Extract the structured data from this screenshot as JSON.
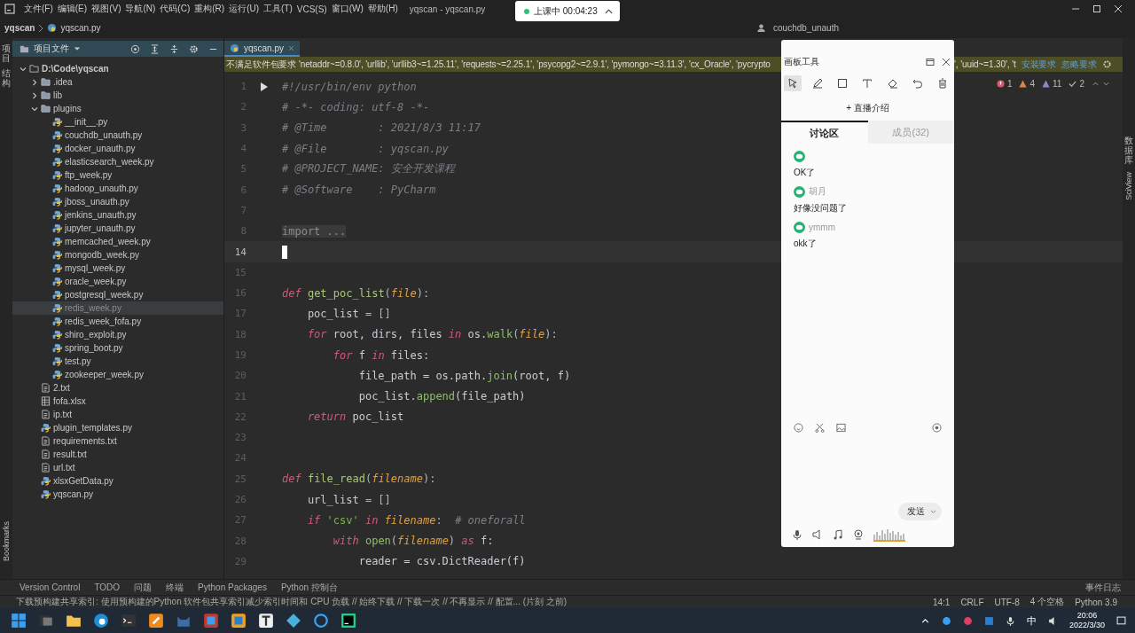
{
  "menu": [
    "文件(F)",
    "编辑(E)",
    "视图(V)",
    "导航(N)",
    "代码(C)",
    "重构(R)",
    "运行(U)",
    "工具(T)",
    "VCS(S)",
    "窗口(W)",
    "帮助(H)"
  ],
  "window": {
    "title": "yqscan - yqscan.py"
  },
  "class_timer": {
    "label": "上课中 00:04:23"
  },
  "breadcrumb": [
    "yqscan",
    "yqscan.py"
  ],
  "run_config": "couchdb_unauth",
  "left_strip": [
    "项目",
    "结构"
  ],
  "bookmarks_label": "Bookmarks",
  "project_panel": {
    "title": "项目文件",
    "tree": [
      {
        "name": "D:\\Code\\yqscan",
        "kind": "folder",
        "expanded": true,
        "selected": false,
        "children": [
          {
            "name": ".idea",
            "kind": "folder",
            "expanded": false,
            "selected": false
          },
          {
            "name": "lib",
            "kind": "folder",
            "expanded": false,
            "selected": false
          },
          {
            "name": "plugins",
            "kind": "folder",
            "expanded": true,
            "selected": false,
            "children": [
              {
                "name": "__init__.py",
                "kind": "init",
                "selected": false
              },
              {
                "name": "couchdb_unauth.py",
                "kind": "python",
                "selected": false
              },
              {
                "name": "docker_unauth.py",
                "kind": "python",
                "selected": false
              },
              {
                "name": "elasticsearch_week.py",
                "kind": "python",
                "selected": false
              },
              {
                "name": "ftp_week.py",
                "kind": "python",
                "selected": false
              },
              {
                "name": "hadoop_unauth.py",
                "kind": "python",
                "selected": false
              },
              {
                "name": "jboss_unauth.py",
                "kind": "python",
                "selected": false
              },
              {
                "name": "jenkins_unauth.py",
                "kind": "python",
                "selected": false
              },
              {
                "name": "jupyter_unauth.py",
                "kind": "python",
                "selected": false
              },
              {
                "name": "memcached_week.py",
                "kind": "python",
                "selected": false
              },
              {
                "name": "mongodb_week.py",
                "kind": "python",
                "selected": false
              },
              {
                "name": "mysql_week.py",
                "kind": "python",
                "selected": false
              },
              {
                "name": "oracle_week.py",
                "kind": "python",
                "selected": false
              },
              {
                "name": "postgresql_week.py",
                "kind": "python",
                "selected": false
              },
              {
                "name": "redis_week.py",
                "kind": "python",
                "selected": true
              },
              {
                "name": "redis_week_fofa.py",
                "kind": "python",
                "selected": false
              },
              {
                "name": "shiro_exploit.py",
                "kind": "python",
                "selected": false
              },
              {
                "name": "spring_boot.py",
                "kind": "python",
                "selected": false
              },
              {
                "name": "test.py",
                "kind": "python",
                "selected": false
              },
              {
                "name": "zookeeper_week.py",
                "kind": "python",
                "selected": false
              }
            ]
          },
          {
            "name": "2.txt",
            "kind": "text",
            "selected": false
          },
          {
            "name": "fofa.xlsx",
            "kind": "excel",
            "selected": false
          },
          {
            "name": "ip.txt",
            "kind": "text",
            "selected": false
          },
          {
            "name": "plugin_templates.py",
            "kind": "python",
            "selected": false
          },
          {
            "name": "requirements.txt",
            "kind": "requirements",
            "selected": false
          },
          {
            "name": "result.txt",
            "kind": "text",
            "selected": false
          },
          {
            "name": "url.txt",
            "kind": "text",
            "selected": false
          },
          {
            "name": "xlsxGetData.py",
            "kind": "python",
            "selected": false
          },
          {
            "name": "yqscan.py",
            "kind": "python",
            "selected": false
          }
        ]
      }
    ]
  },
  "editor_tab": {
    "label": "yqscan.py"
  },
  "requirements_bar": {
    "text": "不满足软件包要求 'netaddr~=0.8.0', 'urllib', 'urllib3~=1.25.11', 'requests~=2.25.1', 'psycopg2~=2.9.1', 'pymongo~=3.11.3', 'cx_Oracle', 'pycrypto",
    "text_end": "', 'uuid~=1.30', 't",
    "install": "安装要求",
    "ignore": "忽略要求"
  },
  "inspections": {
    "errors": "1",
    "warnings": "4",
    "weak_warnings": "11",
    "typos": "2"
  },
  "code": [
    {
      "number": "1",
      "current": false,
      "tokens": [
        {
          "t": "#!/usr/bin/env python",
          "kind": "comment"
        }
      ]
    },
    {
      "number": "2",
      "current": false,
      "tokens": [
        {
          "t": "# -*- coding: utf-8 -*-",
          "kind": "comment"
        }
      ]
    },
    {
      "number": "3",
      "current": false,
      "tokens": [
        {
          "t": "# @Time        : 2021/8/3 11:17",
          "kind": "comment"
        }
      ]
    },
    {
      "number": "4",
      "current": false,
      "tokens": [
        {
          "t": "# @File        : yqscan.py",
          "kind": "comment"
        }
      ]
    },
    {
      "number": "5",
      "current": false,
      "tokens": [
        {
          "t": "# @PROJECT_NAME: 安全开发课程",
          "kind": "comment"
        }
      ]
    },
    {
      "number": "6",
      "current": false,
      "tokens": [
        {
          "t": "# @Software    : PyCharm",
          "kind": "comment"
        }
      ]
    },
    {
      "number": "7",
      "current": false
    },
    {
      "number": "8",
      "current": false,
      "tokens": [
        {
          "t": "import ...",
          "kind": "fold"
        }
      ]
    },
    {
      "number": "14",
      "current": true
    },
    {
      "number": "15",
      "current": false
    },
    {
      "number": "16",
      "current": false,
      "tokens": [
        {
          "t": "def",
          "kind": "keyword"
        },
        {
          "t": " get_poc_list",
          "kind": "func"
        },
        {
          "t": "(",
          "kind": "op"
        },
        {
          "t": "file",
          "kind": "param"
        },
        {
          "t": "):",
          "kind": "op"
        }
      ]
    },
    {
      "number": "17",
      "current": false,
      "tokens": [
        {
          "t": "    poc_list ",
          "kind": "plain"
        },
        {
          "t": "= []",
          "kind": "op"
        }
      ]
    },
    {
      "number": "18",
      "current": false,
      "tokens": [
        {
          "t": "    for",
          "kind": "keyword"
        },
        {
          "t": " root, dirs, files ",
          "kind": "plain"
        },
        {
          "t": "in",
          "kind": "keyword"
        },
        {
          "t": " os.",
          "kind": "plain"
        },
        {
          "t": "walk",
          "kind": "call"
        },
        {
          "t": "(",
          "kind": "op"
        },
        {
          "t": "file",
          "kind": "param"
        },
        {
          "t": "):",
          "kind": "op"
        }
      ]
    },
    {
      "number": "19",
      "current": false,
      "tokens": [
        {
          "t": "        for",
          "kind": "keyword"
        },
        {
          "t": " f ",
          "kind": "plain"
        },
        {
          "t": "in",
          "kind": "keyword"
        },
        {
          "t": " files:",
          "kind": "plain"
        }
      ]
    },
    {
      "number": "20",
      "current": false,
      "tokens": [
        {
          "t": "            file_path = os.path.",
          "kind": "plain"
        },
        {
          "t": "join",
          "kind": "call"
        },
        {
          "t": "(root, f)",
          "kind": "plain"
        }
      ]
    },
    {
      "number": "21",
      "current": false,
      "tokens": [
        {
          "t": "            poc_list.",
          "kind": "plain"
        },
        {
          "t": "append",
          "kind": "call"
        },
        {
          "t": "(file_path)",
          "kind": "plain"
        }
      ]
    },
    {
      "number": "22",
      "current": false,
      "tokens": [
        {
          "t": "    return",
          "kind": "keyword"
        },
        {
          "t": " poc_list",
          "kind": "plain"
        }
      ]
    },
    {
      "number": "23",
      "current": false
    },
    {
      "number": "24",
      "current": false
    },
    {
      "number": "25",
      "current": false,
      "tokens": [
        {
          "t": "def",
          "kind": "keyword"
        },
        {
          "t": " file_read",
          "kind": "func"
        },
        {
          "t": "(",
          "kind": "op"
        },
        {
          "t": "filename",
          "kind": "param"
        },
        {
          "t": "):",
          "kind": "op"
        }
      ]
    },
    {
      "number": "26",
      "current": false,
      "tokens": [
        {
          "t": "    url_list ",
          "kind": "plain"
        },
        {
          "t": "= []",
          "kind": "op"
        }
      ]
    },
    {
      "number": "27",
      "current": false,
      "tokens": [
        {
          "t": "    if",
          "kind": "keyword"
        },
        {
          "t": " 'csv'",
          "kind": "string"
        },
        {
          "t": " in",
          "kind": "keyword"
        },
        {
          "t": " filename",
          "kind": "param"
        },
        {
          "t": ":  ",
          "kind": "op"
        },
        {
          "t": "# oneforall",
          "kind": "comment"
        }
      ]
    },
    {
      "number": "28",
      "current": false,
      "tokens": [
        {
          "t": "        with",
          "kind": "keyword"
        },
        {
          "t": " open",
          "kind": "call"
        },
        {
          "t": "(",
          "kind": "op"
        },
        {
          "t": "filename",
          "kind": "param"
        },
        {
          "t": ")",
          "kind": "op"
        },
        {
          "t": " as",
          "kind": "keyword"
        },
        {
          "t": " f:",
          "kind": "plain"
        }
      ]
    },
    {
      "number": "29",
      "current": false,
      "tokens": [
        {
          "t": "            reader = csv.DictReader(f)",
          "kind": "plain"
        }
      ]
    }
  ],
  "right_strip": {
    "database": "数据库",
    "sciview": "SciView"
  },
  "chat": {
    "title": "画板工具",
    "tools": [
      {
        "kind": "pointer",
        "selected": true
      },
      {
        "kind": "pen",
        "selected": false
      },
      {
        "kind": "rect",
        "selected": false
      },
      {
        "kind": "text",
        "selected": false
      },
      {
        "kind": "eraser",
        "selected": false
      },
      {
        "kind": "undo",
        "selected": false
      },
      {
        "kind": "trash",
        "selected": false
      }
    ],
    "intro": "+ 直播介绍",
    "tabs": [
      {
        "label": "讨论区",
        "selected": true
      },
      {
        "label": "成员(32)",
        "selected": false
      }
    ],
    "messages": [
      {
        "text": "OK了"
      },
      {
        "name": "胡月",
        "text": "好像没问题了"
      },
      {
        "name": "ymmm",
        "text": "okk了"
      }
    ],
    "send": "发送"
  },
  "tool_strip": [
    "Version Control",
    "TODO",
    "问题",
    "终端",
    "Python Packages",
    "Python 控制台"
  ],
  "event_log": "事件日志",
  "status_bar": {
    "message": "下载预构建共享索引: 使用预构建的Python 软件包共享索引减少索引时间和 CPU 负载 // 始终下载 // 下载一次 // 不再显示 // 配置... (片刻 之前)",
    "items": [
      "14:1",
      "CRLF",
      "UTF-8",
      "4 个空格",
      "Python 3.9"
    ]
  },
  "taskbar": {
    "ime": "中",
    "time": "20:06",
    "date": "2022/3/30"
  }
}
